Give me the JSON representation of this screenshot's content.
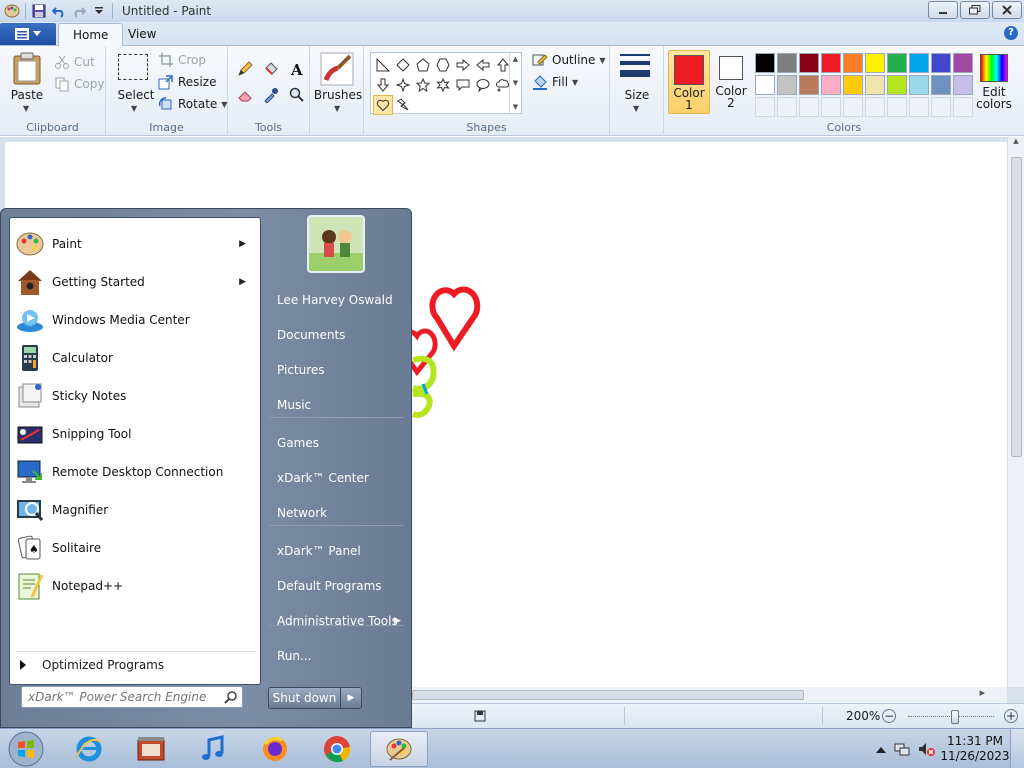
{
  "window": {
    "title": "Untitled - Paint"
  },
  "tabs": [
    {
      "label": "Home"
    },
    {
      "label": "View"
    }
  ],
  "clipboard": {
    "paste_label": "Paste",
    "cut_label": "Cut",
    "copy_label": "Copy",
    "group_label": "Clipboard"
  },
  "image": {
    "select_label": "Select",
    "crop_label": "Crop",
    "resize_label": "Resize",
    "rotate_label": "Rotate",
    "group_label": "Image"
  },
  "tools": {
    "group_label": "Tools",
    "items": [
      "pencil-icon",
      "fill-bucket-icon",
      "text-icon",
      "eraser-icon",
      "color-picker-icon",
      "magnifier-icon"
    ]
  },
  "brushes": {
    "label": "Brushes"
  },
  "shapes": {
    "group_label": "Shapes",
    "outline_label": "Outline",
    "fill_label": "Fill",
    "selected_shape": "heart"
  },
  "size": {
    "label": "Size"
  },
  "colors": {
    "group_label": "Colors",
    "color1_label": "Color\n1",
    "color2_label": "Color\n2",
    "color1": "#ed1c24",
    "color2": "#ffffff",
    "edit_label": "Edit\ncolors",
    "palette_row1": [
      "#000000",
      "#7f7f7f",
      "#880015",
      "#ed1c24",
      "#ff7f27",
      "#fff200",
      "#22b14c",
      "#00a2e8",
      "#3f48cc",
      "#a349a4"
    ],
    "palette_row2": [
      "#ffffff",
      "#c3c3c3",
      "#b97a57",
      "#ffaec9",
      "#ffc90e",
      "#efe4b0",
      "#b5e61d",
      "#99d9ea",
      "#7092be",
      "#c8bfe7"
    ]
  },
  "status": {
    "zoom": "200%"
  },
  "start_menu": {
    "programs": [
      {
        "label": "Paint",
        "icon": "paint-palette-icon",
        "has_submenu": true
      },
      {
        "label": "Getting Started",
        "icon": "birdhouse-icon",
        "has_submenu": true
      },
      {
        "label": "Windows Media Center",
        "icon": "media-center-icon",
        "has_submenu": false
      },
      {
        "label": "Calculator",
        "icon": "calculator-icon",
        "has_submenu": false
      },
      {
        "label": "Sticky Notes",
        "icon": "sticky-notes-icon",
        "has_submenu": false
      },
      {
        "label": "Snipping Tool",
        "icon": "snipping-tool-icon",
        "has_submenu": false
      },
      {
        "label": "Remote Desktop Connection",
        "icon": "remote-desktop-icon",
        "has_submenu": false
      },
      {
        "label": "Magnifier",
        "icon": "magnifier-icon",
        "has_submenu": false
      },
      {
        "label": "Solitaire",
        "icon": "cards-icon",
        "has_submenu": false
      },
      {
        "label": "Notepad++",
        "icon": "notepad-plus-icon",
        "has_submenu": false
      }
    ],
    "all_programs_label": "Optimized Programs",
    "search_placeholder": "xDark™ Power Search Engine",
    "right_links": [
      {
        "label": "Lee Harvey Oswald"
      },
      {
        "label": "Documents"
      },
      {
        "label": "Pictures"
      },
      {
        "label": "Music"
      },
      {
        "label": "Games"
      },
      {
        "label": "xDark™ Center"
      },
      {
        "label": "Network"
      },
      {
        "label": "xDark™ Panel"
      },
      {
        "label": "Default Programs"
      },
      {
        "label": "Administrative Tools",
        "has_submenu": true
      },
      {
        "label": "Run..."
      }
    ],
    "shutdown_label": "Shut down"
  },
  "taskbar": {
    "pinned": [
      "internet-explorer-icon",
      "media-player-icon",
      "music-note-icon",
      "firefox-icon",
      "chrome-icon",
      "paint-palette-icon"
    ],
    "time": "11:31 PM",
    "date": "11/26/2023"
  }
}
